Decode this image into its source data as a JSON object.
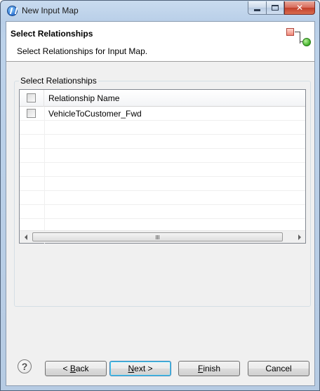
{
  "window": {
    "title": "New Input Map"
  },
  "header": {
    "title": "Select Relationships",
    "description": "Select Relationships for Input Map."
  },
  "group": {
    "label": "Select Relationships",
    "table": {
      "columns": [
        "Relationship Name"
      ],
      "rows": [
        {
          "checked": false,
          "name": "VehicleToCustomer_Fwd"
        }
      ]
    }
  },
  "buttons": {
    "back": {
      "prefix": "< ",
      "mnemonic": "B",
      "rest": "ack"
    },
    "next": {
      "mnemonic": "N",
      "rest": "ext >"
    },
    "finish": {
      "mnemonic": "F",
      "rest": "inish"
    },
    "cancel": "Cancel"
  },
  "help_icon_glyph": "?"
}
